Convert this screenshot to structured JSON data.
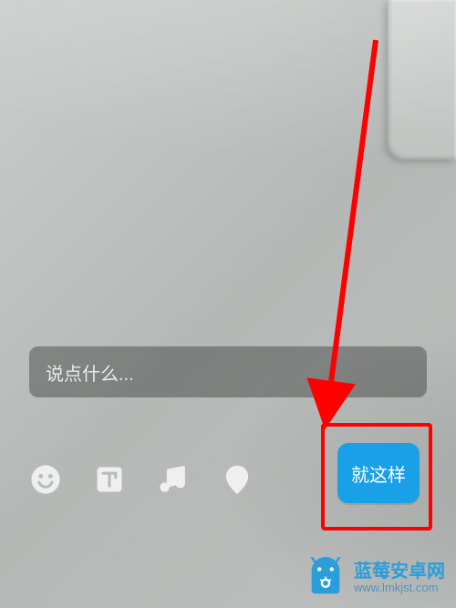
{
  "input": {
    "placeholder": "说点什么..."
  },
  "toolbar": {
    "icons": {
      "emoji": "emoji-icon",
      "text": "text-tool-icon",
      "music": "music-icon",
      "location": "location-icon"
    },
    "submit_label": "就这样"
  },
  "watermark": {
    "title": "蓝莓安卓网",
    "url": "www.lmkjst.com"
  },
  "annotation": {
    "highlight_target": "submit-button",
    "arrow_color": "#ff0000"
  }
}
